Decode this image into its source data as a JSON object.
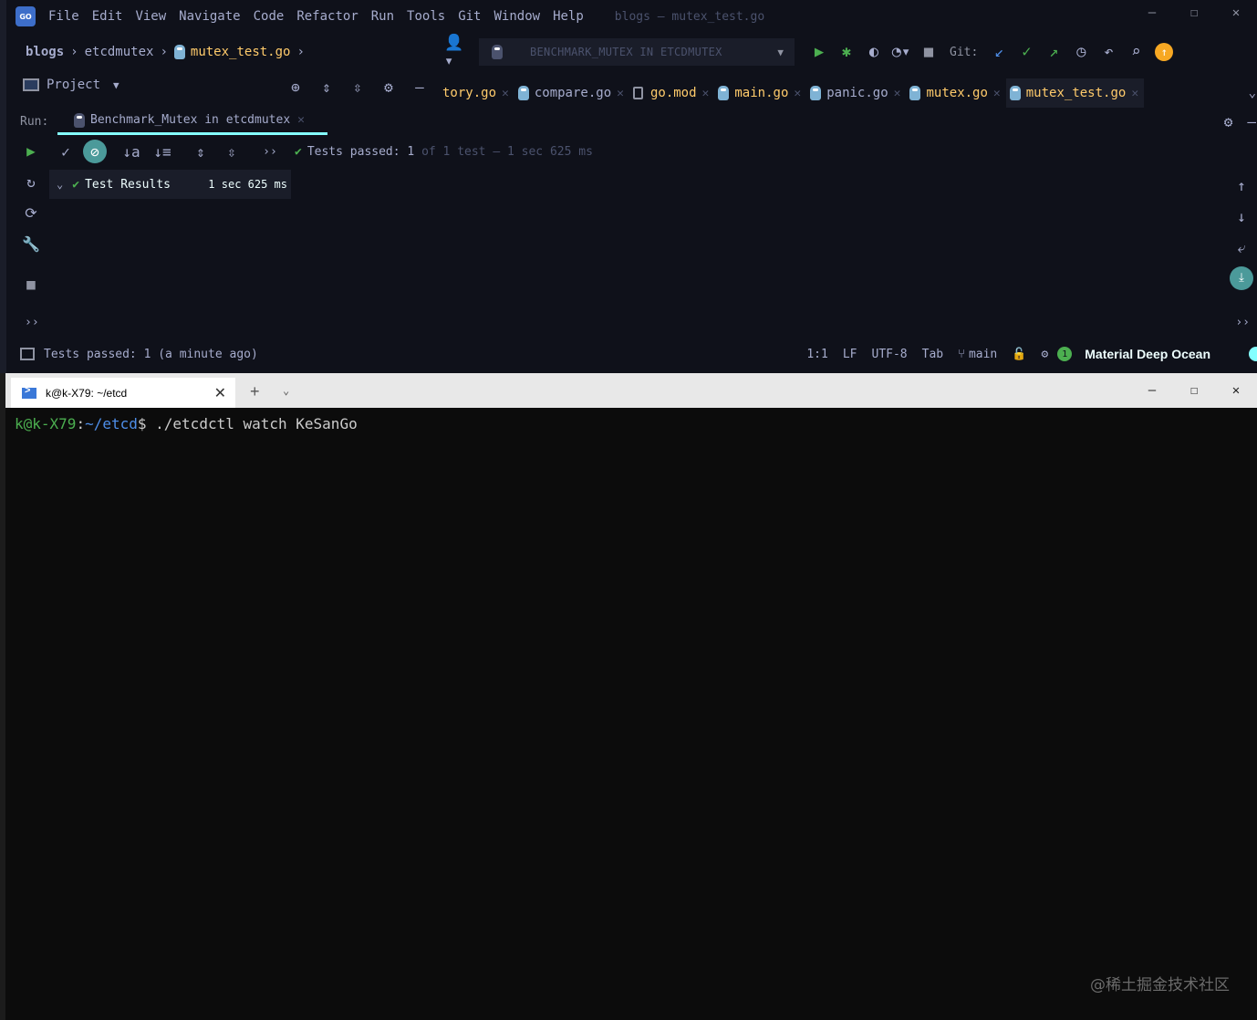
{
  "ide": {
    "menu": [
      "File",
      "Edit",
      "View",
      "Navigate",
      "Code",
      "Refactor",
      "Run",
      "Tools",
      "Git",
      "Window",
      "Help"
    ],
    "window_title": "blogs – mutex_test.go",
    "breadcrumb": [
      "blogs",
      "etcdmutex",
      "mutex_test.go"
    ],
    "run_config": "BENCHMARK_MUTEX IN ETCDMUTEX",
    "git_label": "Git:",
    "project_label": "Project",
    "editor_tabs": [
      "tory.go",
      "compare.go",
      "go.mod",
      "main.go",
      "panic.go",
      "mutex.go",
      "mutex_test.go"
    ],
    "run_label": "Run:",
    "run_tab": "Benchmark_Mutex in etcdmutex",
    "test_status": {
      "prefix": "Tests passed:",
      "count": "1",
      "suffix": "of 1 test – 1 sec 625 ms"
    },
    "tree": {
      "label": "Test Results",
      "duration": "1 sec 625 ms"
    },
    "statusbar": {
      "message": "Tests passed: 1 (a minute ago)",
      "position": "1:1",
      "line_sep": "LF",
      "encoding": "UTF-8",
      "indent": "Tab",
      "branch": "main",
      "notif_count": "1",
      "theme": "Material Deep Ocean"
    },
    "colors": {
      "bg": "#0f111a",
      "accent": "#84ffff",
      "green": "#4caf50",
      "file": "#ffcb6b"
    }
  },
  "terminal": {
    "tab_title": "k@k-X79: ~/etcd",
    "prompt_user": "k@k-X79",
    "prompt_colon": ":",
    "prompt_path": "~/etcd",
    "prompt_symbol": "$",
    "command": " ./etcdctl watch KeSanGo"
  },
  "watermark": "@稀土掘金技术社区"
}
